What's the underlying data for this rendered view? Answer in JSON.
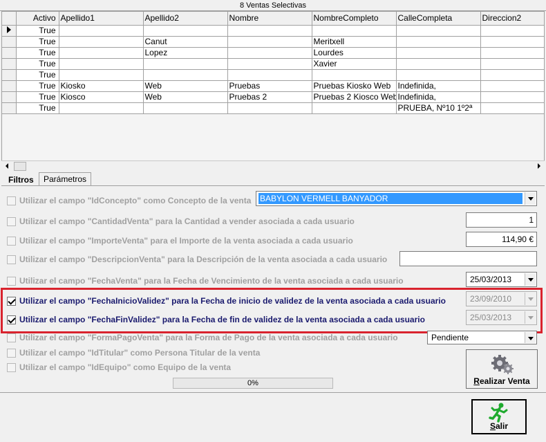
{
  "grid": {
    "title": "8 Ventas Selectivas",
    "columns": [
      "Activo",
      "Apellido1",
      "Apellido2",
      "Nombre",
      "NombreCompleto",
      "CalleCompleta",
      "Direccion2"
    ],
    "rows": [
      [
        "True",
        "",
        "",
        "",
        "",
        "",
        ""
      ],
      [
        "True",
        "",
        "Canut",
        "",
        "Meritxell",
        "",
        ""
      ],
      [
        "True",
        "",
        "Lopez",
        "",
        "Lourdes",
        "",
        ""
      ],
      [
        "True",
        "",
        "",
        "",
        "Xavier",
        "",
        ""
      ],
      [
        "True",
        "",
        "",
        "",
        "",
        "",
        ""
      ],
      [
        "True",
        "Kiosko",
        "Web",
        "Pruebas",
        "Pruebas Kiosko Web",
        "Indefinida,",
        ""
      ],
      [
        "True",
        "Kiosco",
        "Web",
        "Pruebas 2",
        "Pruebas 2 Kiosco Web",
        "Indefinida,",
        ""
      ],
      [
        "True",
        "",
        "",
        "",
        "",
        "PRUEBA, Nº10 1º2ª",
        ""
      ]
    ]
  },
  "tabs": {
    "filtros": "Filtros",
    "parametros": "Parámetros"
  },
  "options": {
    "idconcepto": "Utilizar el campo \"IdConcepto\" como Concepto de la venta",
    "cantidad": "Utilizar el campo \"CantidadVenta\" para la Cantidad a vender asociada a cada usuario",
    "importe": "Utilizar el campo \"ImporteVenta\" para el Importe de la venta asociada a cada usuario",
    "descripcion": "Utilizar el campo \"DescripcionVenta\" para la Descripción de la venta asociada a cada usuario",
    "fechaventa": "Utilizar el campo \"FechaVenta\" para la Fecha de Vencimiento de la venta asociada a cada usuario",
    "fechainicio": "Utilizar el campo \"FechaInicioValidez\" para la Fecha de inicio de validez de la venta asociada a cada usuario",
    "fechafin": "Utilizar el campo \"FechaFinValidez\" para la Fecha de fin de validez de la venta asociada a cada usuario",
    "formapago": "Utilizar el campo \"FormaPagoVenta\" para la Forma de Pago de la venta asociada a cada usuario",
    "idtitular": "Utilizar el campo \"IdTitular\" como Persona Titular de la venta",
    "idequipo": "Utilizar el campo \"IdEquipo\" como Equipo de la venta"
  },
  "values": {
    "concepto": "BABYLON VERMELL BANYADOR",
    "cantidad": "1",
    "importe": "114,90 €",
    "descripcion": "",
    "fechaventa": "25/03/2013",
    "fechainicio": "23/09/2010",
    "fechafin": "25/03/2013",
    "formapago": "Pendiente"
  },
  "progress": "0%",
  "buttons": {
    "realizar": "Realizar Venta",
    "salir": "Salir"
  },
  "colors": {
    "highlight": "#d9232e",
    "selection": "#3399ff",
    "checked_text": "#1a1a6e"
  }
}
